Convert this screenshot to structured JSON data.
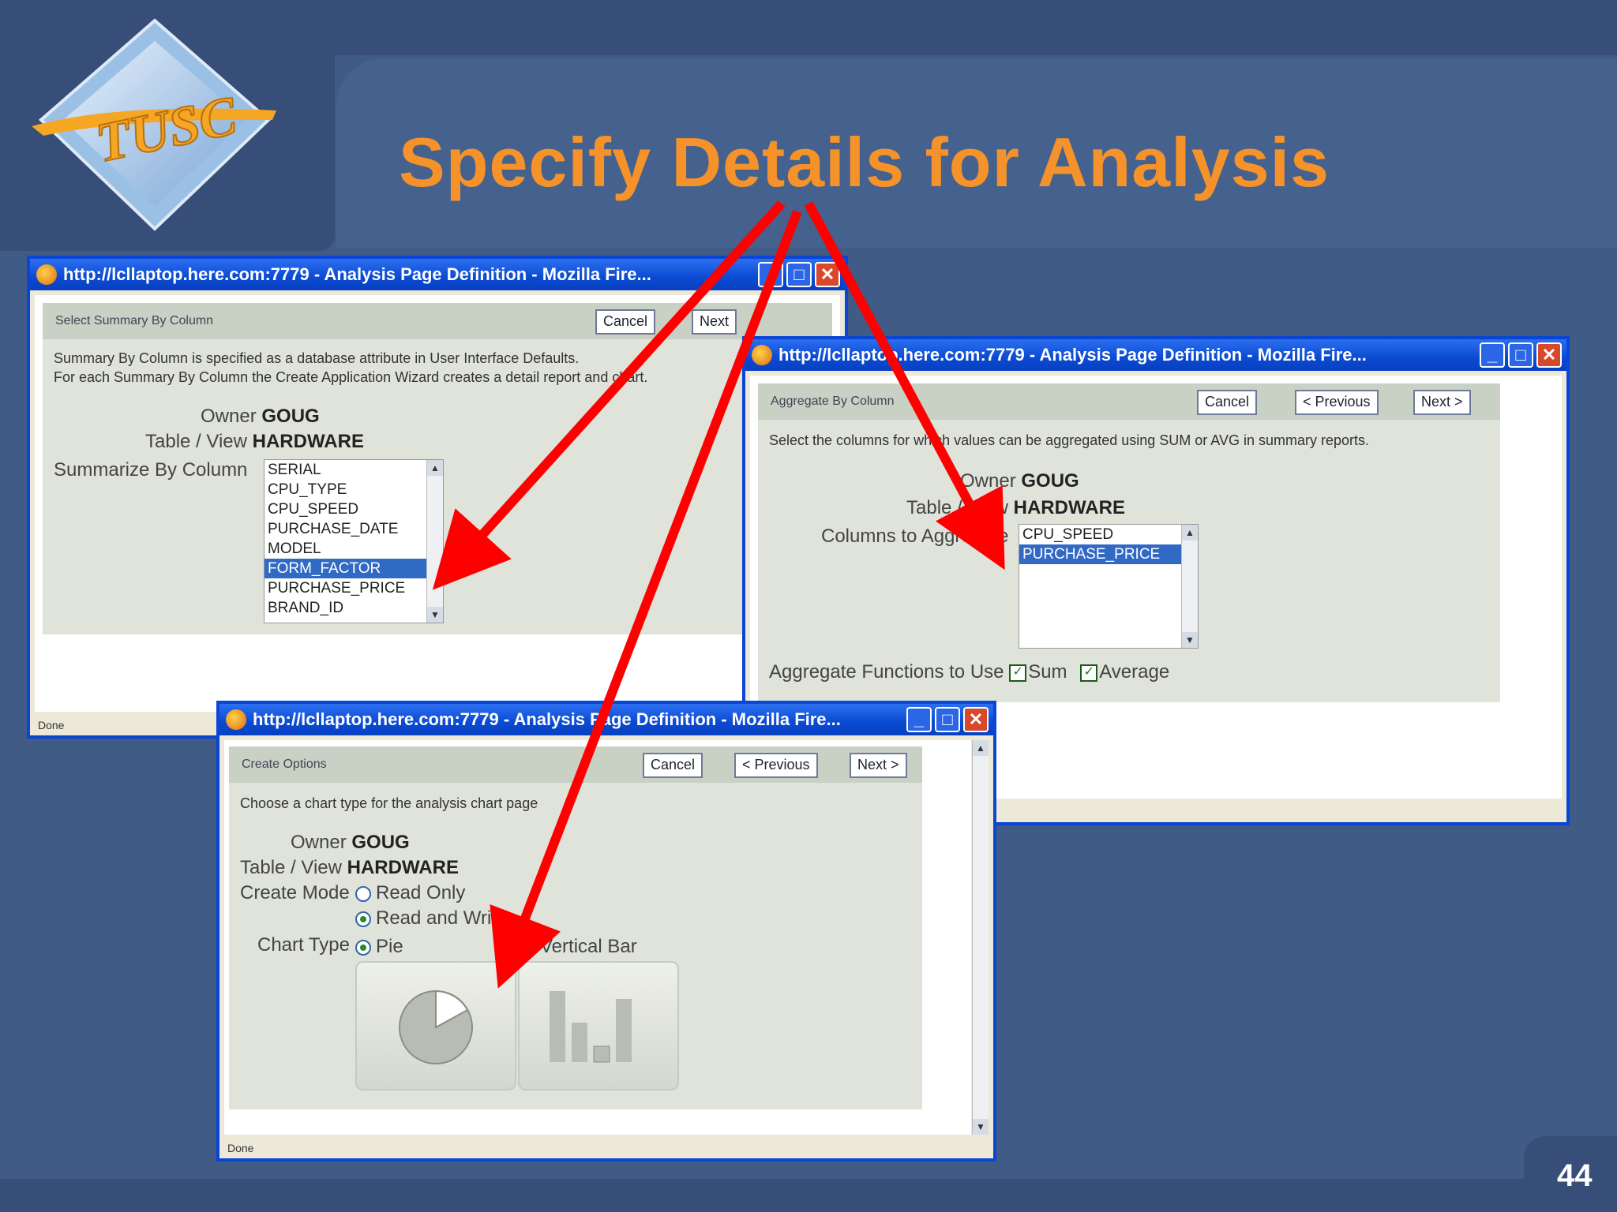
{
  "slide": {
    "title": "Specify Details for Analysis",
    "logo_text": "TUSC",
    "page_number": "44"
  },
  "window1": {
    "title": "http://lcllaptop.here.com:7779 - Analysis Page Definition - Mozilla Fire...",
    "panel_header": "Select Summary By Column",
    "cancel_label": "Cancel",
    "next_label": "Next",
    "description_line1": "Summary By Column is specified as a database attribute in User Interface Defaults.",
    "description_line2": "For each Summary By Column the Create Application Wizard creates a detail report and chart.",
    "owner_label": "Owner",
    "owner_value": "GOUG",
    "table_label": "Table / View",
    "table_value": "HARDWARE",
    "summarize_label": "Summarize By Column",
    "columns": [
      "SERIAL",
      "CPU_TYPE",
      "CPU_SPEED",
      "PURCHASE_DATE",
      "MODEL",
      "FORM_FACTOR",
      "PURCHASE_PRICE",
      "BRAND_ID"
    ],
    "selected_column": "FORM_FACTOR",
    "status": "Done"
  },
  "window2": {
    "title": "http://lcllaptop.here.com:7779 - Analysis Page Definition - Mozilla Fire...",
    "panel_header": "Aggregate By Column",
    "cancel_label": "Cancel",
    "previous_label": "< Previous",
    "next_label": "Next >",
    "description": "Select the columns for which values can be aggregated using SUM or AVG in summary reports.",
    "owner_label": "Owner",
    "owner_value": "GOUG",
    "table_label": "Table / View",
    "table_value": "HARDWARE",
    "columns_label": "Columns to Aggregate",
    "columns": [
      "CPU_SPEED",
      "PURCHASE_PRICE"
    ],
    "selected_column": "PURCHASE_PRICE",
    "functions_label": "Aggregate Functions to Use",
    "sum_label": "Sum",
    "sum_checked": true,
    "average_label": "Average",
    "average_checked": true
  },
  "window3": {
    "title": "http://lcllaptop.here.com:7779 - Analysis Page Definition - Mozilla Fire...",
    "panel_header": "Create Options",
    "cancel_label": "Cancel",
    "previous_label": "< Previous",
    "next_label": "Next >",
    "description": "Choose a chart type for the analysis chart page",
    "owner_label": "Owner",
    "owner_value": "GOUG",
    "table_label": "Table / View",
    "table_value": "HARDWARE",
    "create_mode_label": "Create Mode",
    "mode_read_only": "Read Only",
    "mode_read_write": "Read and Write",
    "selected_mode": "Read and Write",
    "chart_type_label": "Chart Type",
    "chart_pie": "Pie",
    "chart_vertical_bar": "Vertical Bar",
    "selected_chart": "Pie",
    "status": "Done"
  },
  "colors": {
    "title_orange": "#f5922a",
    "slide_blue": "#3f5b86",
    "window_blue": "#0a46d4",
    "arrow_red": "#ff0000"
  }
}
